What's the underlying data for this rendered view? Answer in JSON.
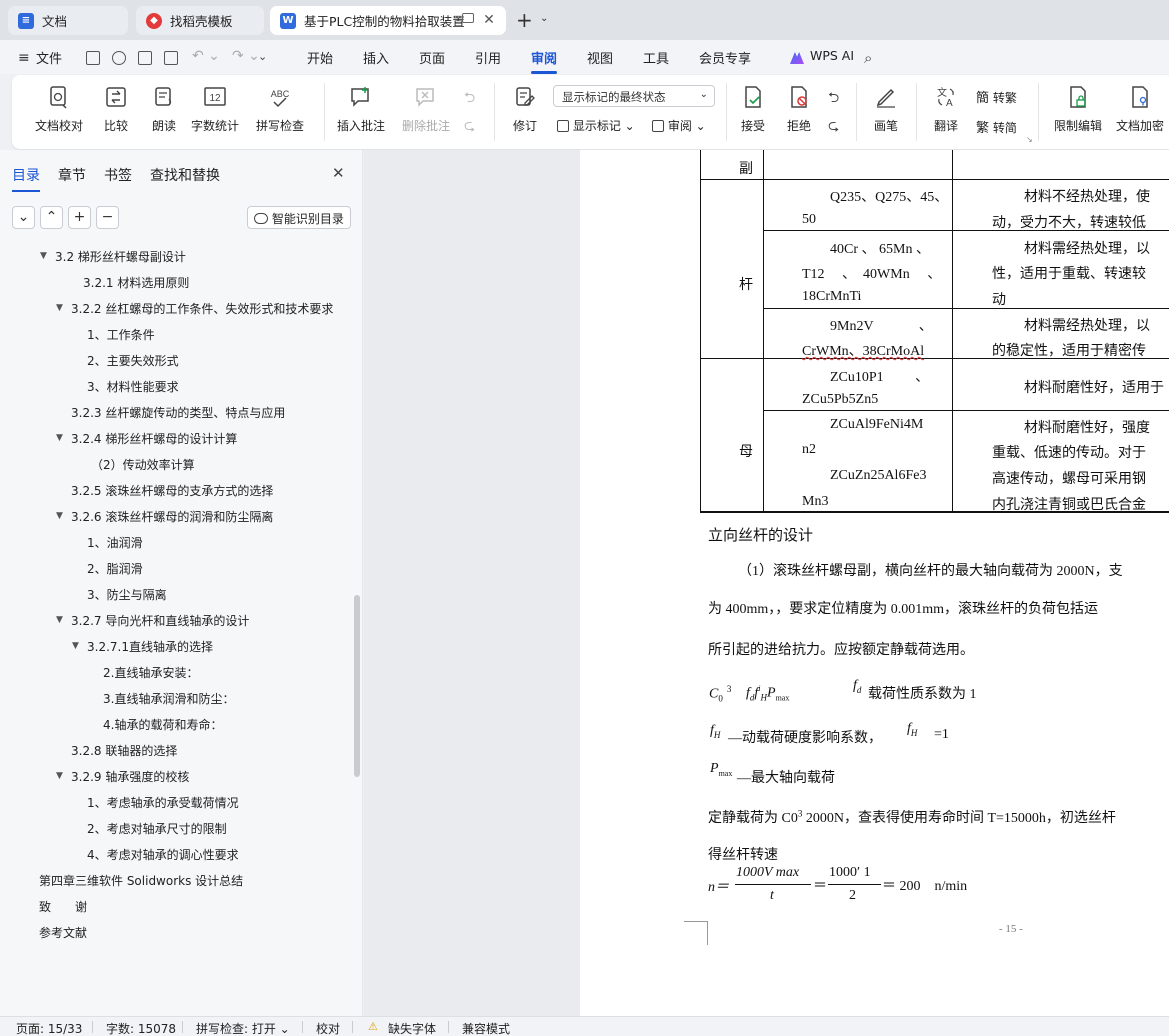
{
  "tabs": [
    {
      "label": "文档",
      "icon": "doc-icon",
      "color": "#2f6bdc"
    },
    {
      "label": "找稻壳模板",
      "icon": "docer-icon",
      "color": "#e33b3b"
    },
    {
      "label": "基于PLC控制的物料拾取装置I",
      "icon": "word-icon",
      "color": "#2f6bdc"
    }
  ],
  "menu": {
    "file": "文件",
    "items": [
      "开始",
      "插入",
      "页面",
      "引用",
      "审阅",
      "视图",
      "工具",
      "会员专享"
    ],
    "active": "审阅",
    "ai": "WPS AI"
  },
  "ribbon": {
    "proofread": "文档校对",
    "compare": "比较",
    "read_aloud": "朗读",
    "word_count": "字数统计",
    "spell_check": "拼写检查",
    "insert_comment": "插入批注",
    "delete_comment": "删除批注",
    "track_changes": "修订",
    "markup_state": "显示标记的最终状态",
    "show_markup": "显示标记",
    "review": "审阅",
    "accept": "接受",
    "reject": "拒绝",
    "ink": "画笔",
    "translate": "翻译",
    "to_traditional": "转繁",
    "to_simplified": "转简",
    "restrict_edit": "限制编辑",
    "encrypt": "文档加密"
  },
  "panel": {
    "tabs": [
      "目录",
      "章节",
      "书签",
      "查找和替换"
    ],
    "smart_toc": "智能识别目录",
    "toc": [
      {
        "text": "3.2 梯形丝杆螺母副设计",
        "caret": "down"
      },
      {
        "text": "3.2.1 材料选用原则"
      },
      {
        "text": "3.2.2 丝杠螺母的工作条件、失效形式和技术要求",
        "caret": "down"
      },
      {
        "text": "1、工作条件"
      },
      {
        "text": "2、主要失效形式"
      },
      {
        "text": "3、材料性能要求"
      },
      {
        "text": "3.2.3 丝杆螺旋传动的类型、特点与应用"
      },
      {
        "text": "3.2.4 梯形丝杆螺母的设计计算",
        "caret": "down"
      },
      {
        "text": "（2）传动效率计算"
      },
      {
        "text": "3.2.5 滚珠丝杆螺母的支承方式的选择"
      },
      {
        "text": "3.2.6 滚珠丝杆螺母的润滑和防尘隔离",
        "caret": "down"
      },
      {
        "text": "1、油润滑"
      },
      {
        "text": "2、脂润滑"
      },
      {
        "text": "3、防尘与隔离"
      },
      {
        "text": "3.2.7 导向光杆和直线轴承的设计",
        "caret": "down"
      },
      {
        "text": "3.2.7.1直线轴承的选择",
        "caret": "down"
      },
      {
        "text": "2.直线轴承安装："
      },
      {
        "text": "3.直线轴承润滑和防尘："
      },
      {
        "text": "4.轴承的载荷和寿命："
      },
      {
        "text": "3.2.8 联轴器的选择"
      },
      {
        "text": "3.2.9 轴承强度的校核",
        "caret": "down"
      },
      {
        "text": "1、考虑轴承的承受载荷情况"
      },
      {
        "text": "2、考虑对轴承尺寸的限制"
      },
      {
        "text": "4、考虑对轴承的调心性要求"
      },
      {
        "text": "第四章三维软件 Solidworks 设计总结"
      },
      {
        "text": "致　　谢"
      },
      {
        "text": "参考文献"
      }
    ]
  },
  "doc": {
    "table": {
      "r0c0": "副",
      "r1c0": "杆",
      "r1a_mat": [
        "Q235、Q275、45、",
        "50"
      ],
      "r1a_desc": [
        "材料不经热处理，使",
        "动，受力不大，转速较低"
      ],
      "r1b_mat": [
        "40Cr 、 65Mn 、",
        "T12 　、　40WMn 　、",
        "18CrMnTi"
      ],
      "r1b_desc": [
        "材料需经热处理，以",
        "性，适用于重载、转速较",
        "动"
      ],
      "r1c_mat": [
        "9Mn2V 　　　、",
        "CrWMn、38CrMoAl"
      ],
      "r1c_desc": [
        "材料需经热处理，以",
        "的稳定性，适用于精密传"
      ],
      "r2c0": "母",
      "r2a_mat": [
        "ZCu10P1 　　、",
        "ZCu5Pb5Zn5"
      ],
      "r2a_desc": [
        "材料耐磨性好，适用于"
      ],
      "r2b_mat": [
        "ZCuAl9FeNi4M",
        "n2",
        "ZCuZn25Al6Fe3",
        "Mn3"
      ],
      "r2b_desc": [
        "材料耐磨性好，强度",
        "重载、低速的传动。对于",
        "高速传动，螺母可采用钢",
        "内孔浇注青铜或巴氏合金"
      ]
    },
    "heading": "立向丝杆的设计",
    "para1": "（1）滚珠丝杆螺母副，横向丝杆的最大轴向载荷为 2000N，支",
    "para2": "为 400mm，，要求定位精度为 0.001mm，滚珠丝杆的负荷包括运",
    "para3": "所引起的进给抗力。应按额定静载荷选用。",
    "f1_lhs": "C",
    "f1_sub": "0",
    "f1_sup": "3",
    "f1_rhs": "f",
    "f1_note_sym": "f",
    "f1_note": "载荷性质系数为 1",
    "f2_sym": "f",
    "f2_sub": "H",
    "f2_text": "—动载荷硬度影响系数，",
    "f2_val": "=1",
    "f3_sym": "P",
    "f3_sub": "max",
    "f3_text": "—最大轴向载荷",
    "para4": "定静载荷为 C0",
    "para4_sup": "3",
    "para4b": " 2000N，查表得使用寿命时间 T=15000h，初选丝杆",
    "para5": "得丝杆转速",
    "eq_n": "n＝",
    "eq_num1": "1000V max",
    "eq_den1": "t",
    "eq_eq": "＝",
    "eq_num2": "1000′ 1",
    "eq_den2": "2",
    "eq_res": "＝ 200　n/min",
    "page_num": "- 15 -"
  },
  "status": {
    "page": "页面: 15/33",
    "words": "字数: 15078",
    "spell": "拼写检查: 打开",
    "proof": "校对",
    "missing_font": "缺失字体",
    "compat": "兼容模式"
  }
}
